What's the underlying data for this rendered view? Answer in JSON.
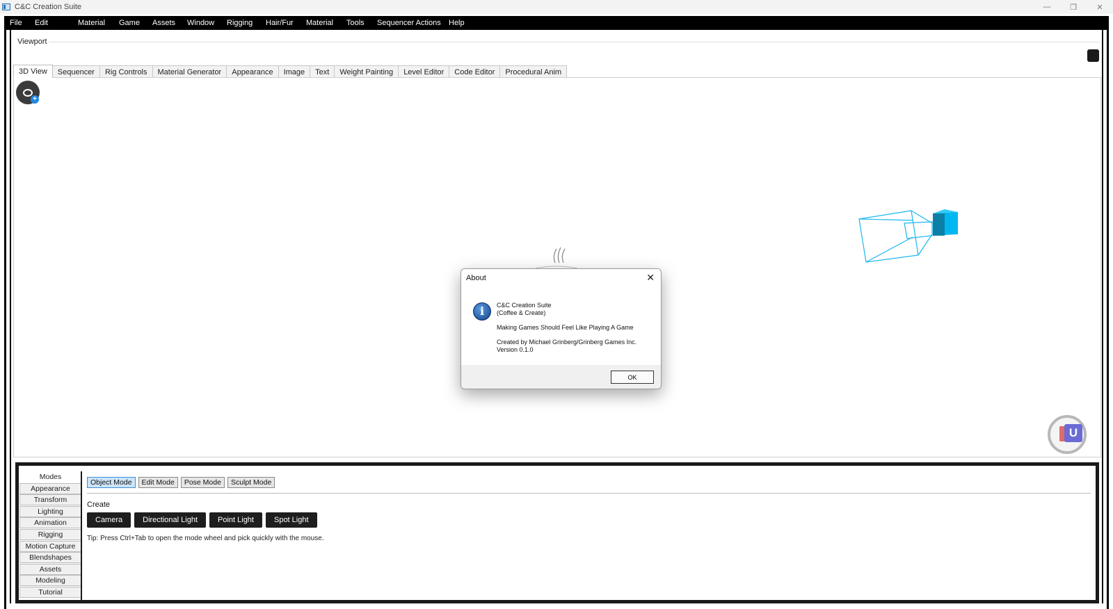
{
  "window": {
    "title": "C&C Creation Suite",
    "controls": {
      "minimize": "—",
      "restore": "❐",
      "close": "✕"
    }
  },
  "menubar": {
    "items": [
      "File",
      "Edit",
      "Material",
      "Game",
      "Assets",
      "Window",
      "Rigging",
      "Hair/Fur",
      "Material",
      "Tools",
      "Sequencer Actions",
      "Help"
    ]
  },
  "viewport": {
    "label": "Viewport",
    "tabs": [
      "3D View",
      "Sequencer",
      "Rig Controls",
      "Material Generator",
      "Appearance",
      "Image",
      "Text",
      "Weight Painting",
      "Level Editor",
      "Code Editor",
      "Procedural Anim"
    ],
    "active_tab": "3D View",
    "accent_color": "#00b7f0"
  },
  "about_dialog": {
    "title": "About",
    "app_name": "C&C Creation Suite",
    "subtitle": "(Coffee & Create)",
    "tagline": "Making Games Should Feel Like Playing A Game",
    "credits": "Created by Michael Grinberg/Grinberg Games Inc.",
    "version": "Version 0.1.0",
    "ok_label": "OK",
    "icon": "info-icon"
  },
  "bottom_panel": {
    "side_tabs": [
      "Modes",
      "Appearance",
      "Transform",
      "Lighting",
      "Animation",
      "Rigging",
      "Motion Capture",
      "Blendshapes",
      "Assets",
      "Modeling",
      "Tutorial"
    ],
    "active_side_tab": "Modes",
    "modes": [
      "Object Mode",
      "Edit Mode",
      "Pose Mode",
      "Sculpt Mode"
    ],
    "active_mode": "Object Mode",
    "create_label": "Create",
    "create_buttons": [
      "Camera",
      "Directional Light",
      "Point Light",
      "Spot Light"
    ],
    "tip": "Tip: Press Ctrl+Tab to open the mode wheel and pick quickly with the mouse."
  },
  "gizmo": {
    "face_label": "U"
  }
}
